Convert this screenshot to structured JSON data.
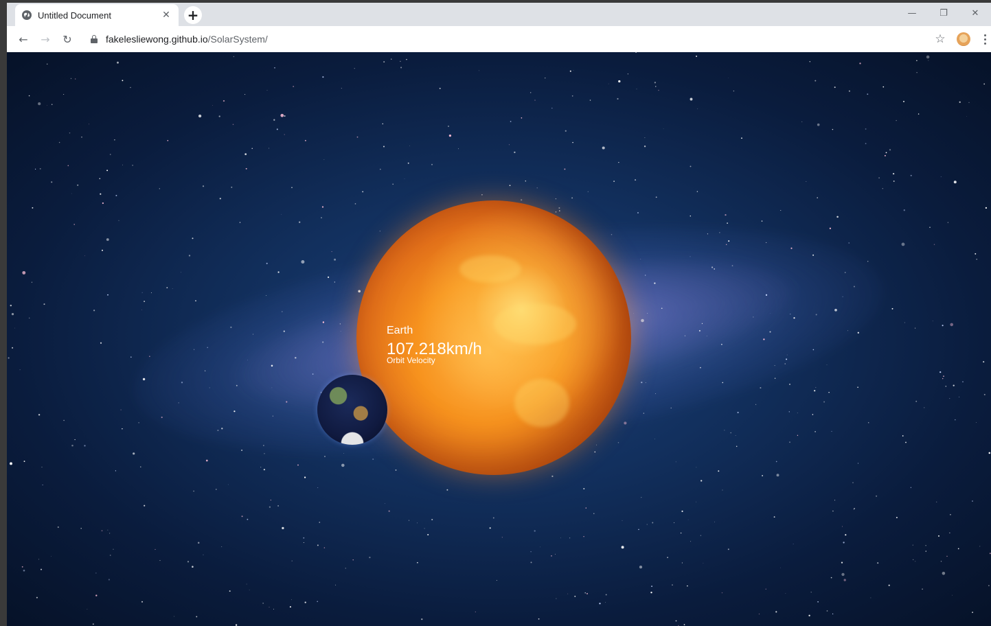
{
  "tab": {
    "title": "Untitled Document",
    "close": "✕",
    "favicon": "globe-icon"
  },
  "new_tab": {
    "label": "+"
  },
  "window_controls": {
    "minimize": "—",
    "restore": "❐",
    "close": "✕"
  },
  "toolbar": {
    "back": "←",
    "forward": "→",
    "reload": "↻",
    "star": "☆"
  },
  "url": {
    "host": "fakelesliewong.github.io",
    "path": "/SolarSystem/"
  },
  "page": {
    "planet_name": "Earth",
    "velocity": "107.218km/h",
    "velocity_caption": "Orbit Velocity"
  },
  "colors": {
    "tab_strip": "#dee1e6",
    "text_primary": "#202124",
    "text_secondary": "#5f6368",
    "space": "#0a1c3d",
    "sun": "#f7931e"
  }
}
